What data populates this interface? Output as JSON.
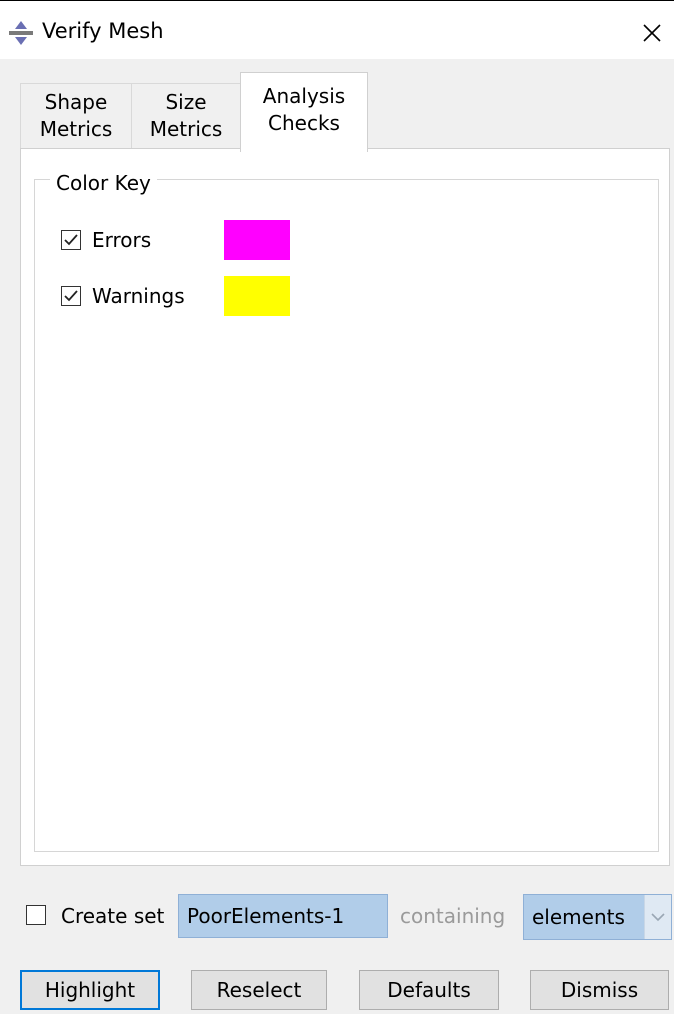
{
  "window": {
    "title": "Verify Mesh"
  },
  "tabs": [
    {
      "line1": "Shape",
      "line2": "Metrics"
    },
    {
      "line1": "Size",
      "line2": "Metrics"
    },
    {
      "line1": "Analysis",
      "line2": "Checks",
      "active": true
    }
  ],
  "color_key": {
    "label": "Color Key",
    "items": [
      {
        "label": "Errors",
        "checked": true,
        "color": "#ff00ff"
      },
      {
        "label": "Warnings",
        "checked": true,
        "color": "#ffff00"
      }
    ]
  },
  "set_options": {
    "create_set_label": "Create set",
    "create_set_checked": false,
    "set_name": "PoorElements-1",
    "containing_label": "containing",
    "containing_value": "elements"
  },
  "buttons": {
    "highlight": "Highlight",
    "reselect": "Reselect",
    "defaults": "Defaults",
    "dismiss": "Dismiss"
  },
  "icons": {
    "app": "mesh-app-icon",
    "close": "close-icon",
    "check": "checkmark-icon",
    "dropdown": "chevron-down-icon"
  }
}
